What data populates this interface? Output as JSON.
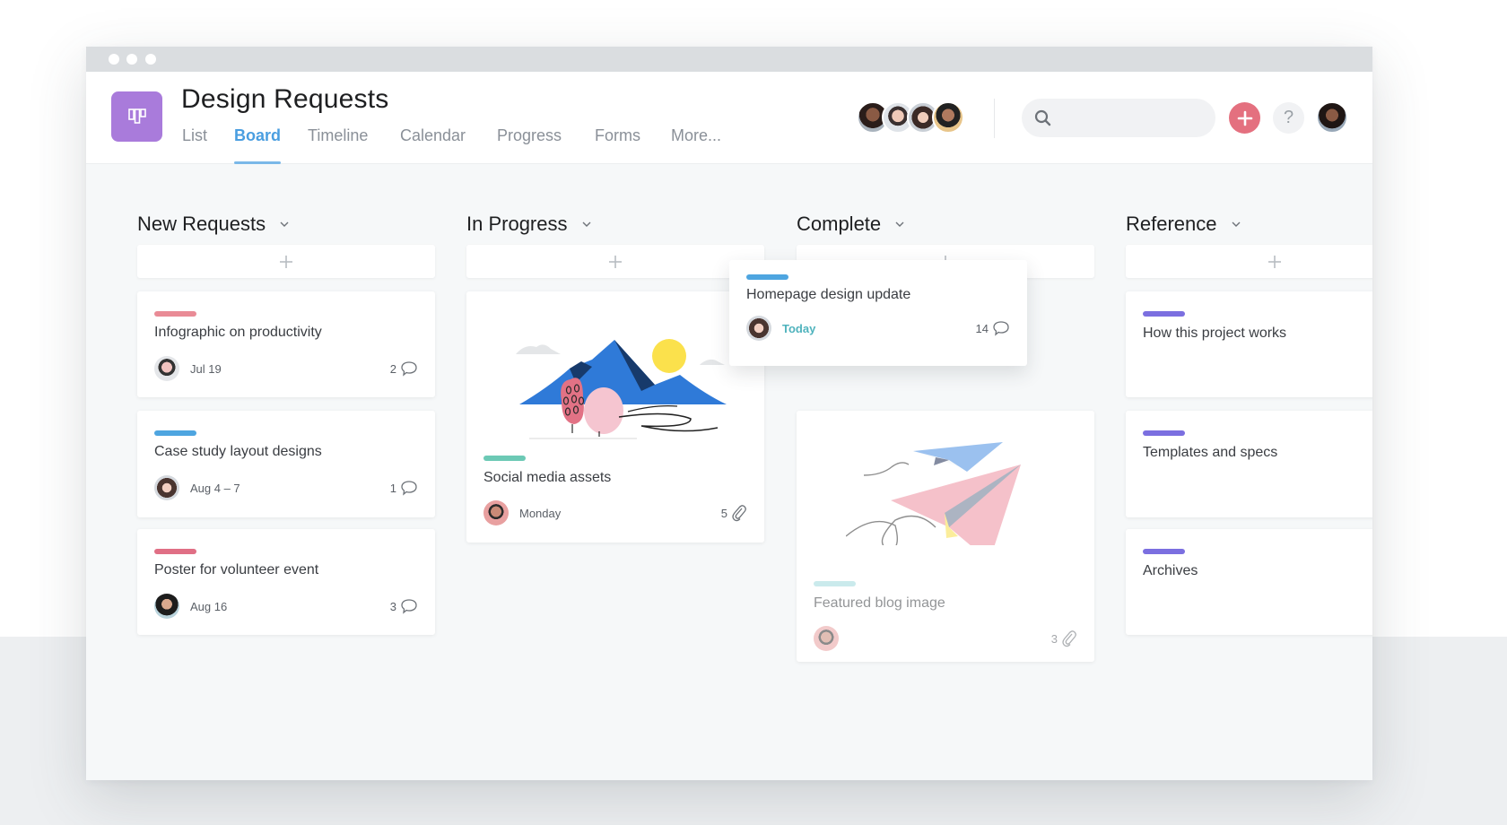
{
  "window": {
    "controls": [
      "dot",
      "dot",
      "dot"
    ]
  },
  "project": {
    "title": "Design Requests",
    "icon": "board-icon",
    "icon_color": "#A97BDB"
  },
  "tabs": [
    {
      "label": "List",
      "active": false
    },
    {
      "label": "Board",
      "active": true
    },
    {
      "label": "Timeline",
      "active": false
    },
    {
      "label": "Calendar",
      "active": false
    },
    {
      "label": "Progress",
      "active": false
    },
    {
      "label": "Forms",
      "active": false
    },
    {
      "label": "More...",
      "active": false
    }
  ],
  "header": {
    "members_count": 4,
    "search": {
      "placeholder": "",
      "value": ""
    },
    "add_button_icon": "plus-icon",
    "add_button_color": "#E4707F",
    "help_label": "?",
    "accent_color": "#4A9EE0"
  },
  "columns": [
    {
      "title": "New Requests",
      "add_label": "+",
      "cards": [
        {
          "title": "Infographic on productivity",
          "tag_color": "#E98B96",
          "due": "Jul 19",
          "count": "2",
          "count_icon": "comment-icon"
        },
        {
          "title": "Case study layout designs",
          "tag_color": "#4EA5E0",
          "due": "Aug 4 – 7",
          "count": "1",
          "count_icon": "comment-icon"
        },
        {
          "title": "Poster for volunteer event",
          "tag_color": "#E06F85",
          "due": "Aug 16",
          "count": "3",
          "count_icon": "comment-icon"
        }
      ]
    },
    {
      "title": "In Progress",
      "add_label": "+",
      "cards": [
        {
          "title": "Social media assets",
          "tag_color": "#6CC9B5",
          "due": "Monday",
          "count": "5",
          "count_icon": "attachment-icon",
          "image": "mountain-illustration"
        }
      ]
    },
    {
      "title": "Complete",
      "add_label": "+",
      "cards": [
        {
          "title": "Featured blog image",
          "tag_color": "#9FD9DE",
          "due": "",
          "count": "3",
          "count_icon": "attachment-icon",
          "image": "paper-planes-illustration",
          "completed": true
        }
      ]
    },
    {
      "title": "Reference",
      "add_label": "+",
      "cards": [
        {
          "title": "How this project works",
          "tag_color": "#7B6FE0"
        },
        {
          "title": "Templates and specs",
          "tag_color": "#7B6FE0"
        },
        {
          "title": "Archives",
          "tag_color": "#7B6FE0"
        }
      ]
    }
  ],
  "dragging_card": {
    "title": "Homepage design update",
    "tag_color": "#4EA5E0",
    "due": "Today",
    "count": "14",
    "count_icon": "comment-icon"
  }
}
